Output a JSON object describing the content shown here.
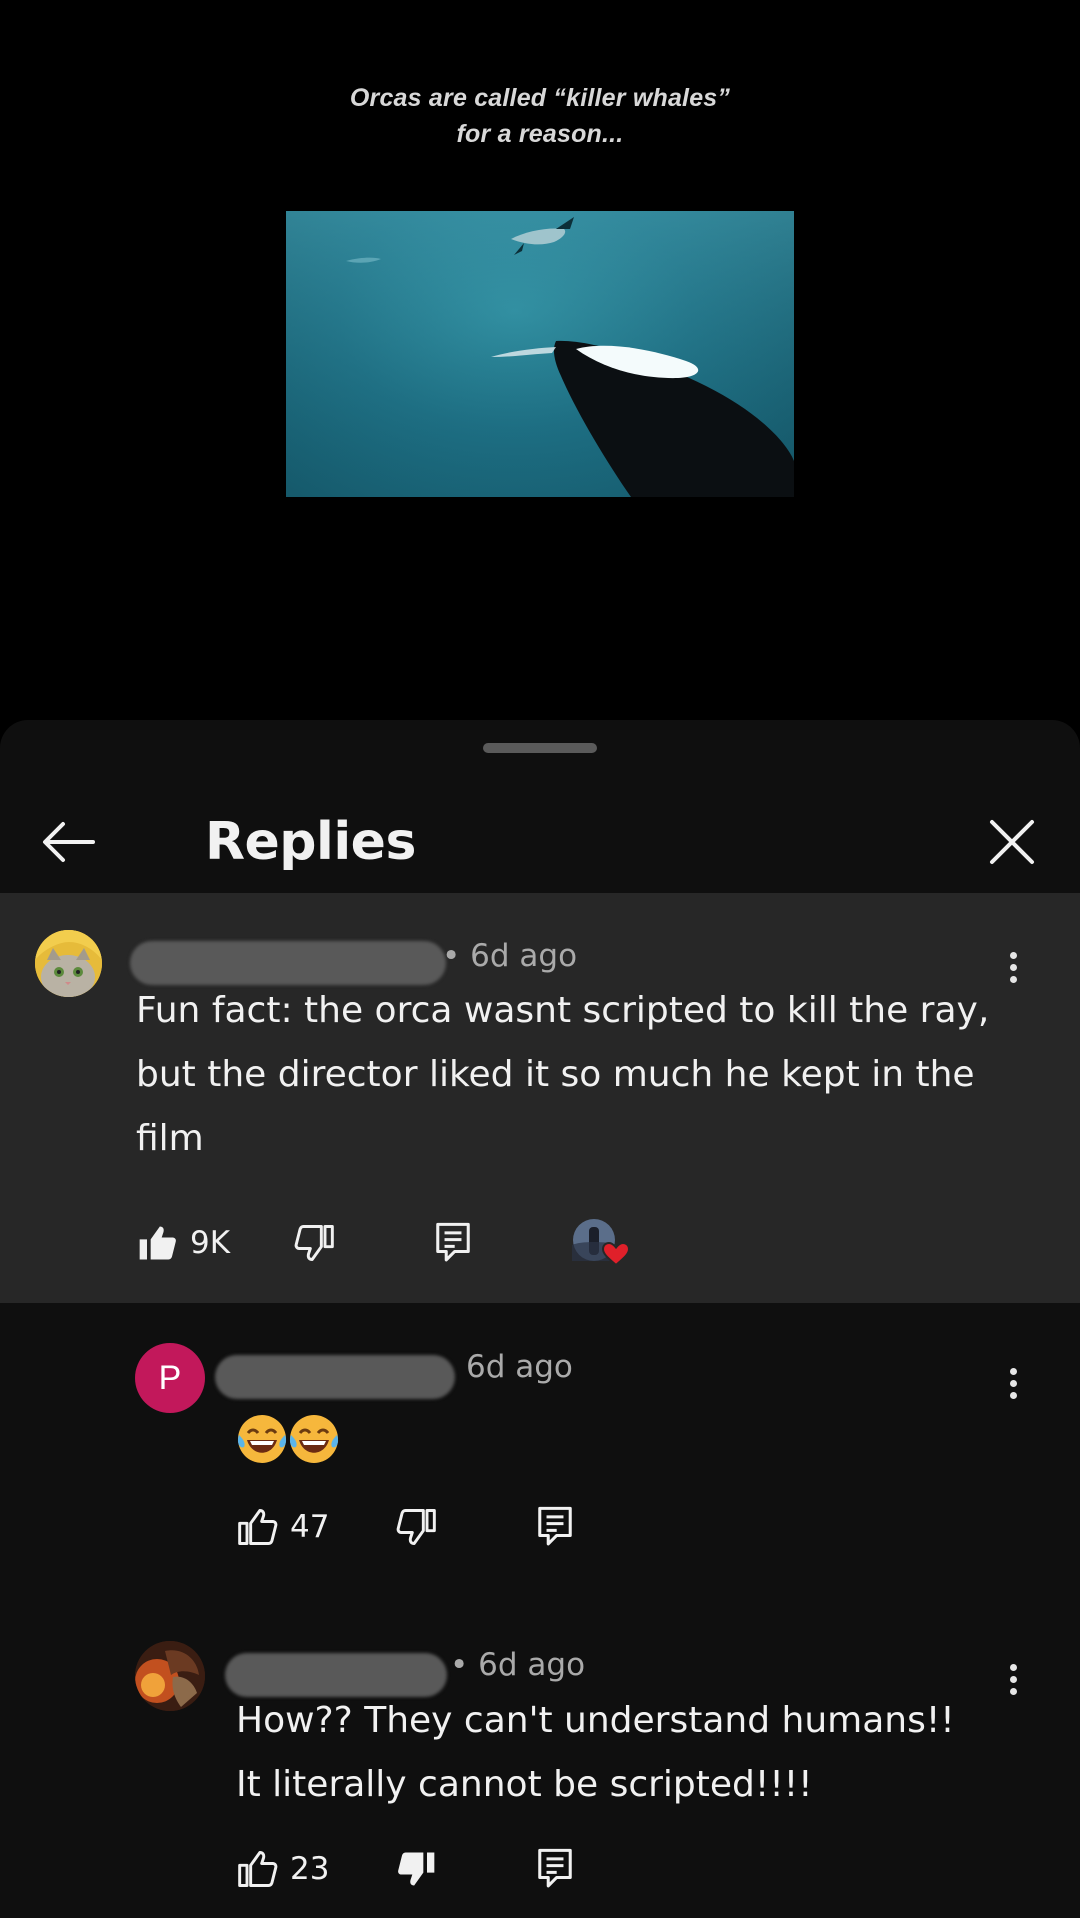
{
  "video": {
    "caption_line1": "Orcas are called “killer whales”",
    "caption_line2": "for a reason..."
  },
  "sheet": {
    "title": "Replies"
  },
  "comments": [
    {
      "time": "• 6d ago",
      "text": "Fun fact: the orca wasnt scripted to kill the ray, but the director liked it so much he kept in the film",
      "likes": "9K",
      "liked": true,
      "creator_hearted": true
    },
    {
      "avatar_letter": "P",
      "avatar_color": "#c2185b",
      "time": "6d ago",
      "text": "😂😂",
      "likes": "47"
    },
    {
      "time": "• 6d ago",
      "text_line1": "How?? They can't understand humans!!",
      "text_line2": "It literally cannot be scripted!!!!",
      "likes": "23",
      "disliked": true
    }
  ],
  "icons": {
    "back": "arrow-left-icon",
    "close": "close-icon",
    "like": "thumbs-up-icon",
    "dislike": "thumbs-down-icon",
    "reply": "reply-icon",
    "menu": "more-vert-icon",
    "heart": "heart-icon"
  },
  "colors": {
    "sheet_bg": "#0f0f0f",
    "highlight_bg": "#272727",
    "heart": "#e0202a"
  }
}
